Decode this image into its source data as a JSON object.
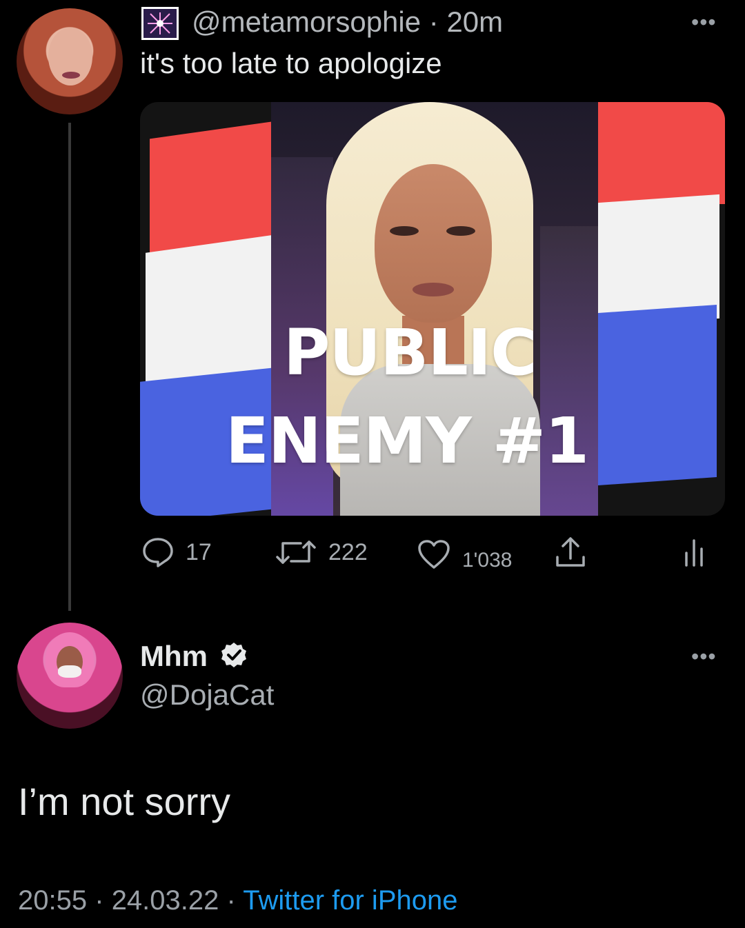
{
  "original_tweet": {
    "handle": "@metamorsophie",
    "separator": "·",
    "time_ago": "20m",
    "text": "it's too late to apologize",
    "media": {
      "headline_line1": "PUBLIC",
      "headline_line2": "ENEMY #1"
    },
    "actions": {
      "reply_count": "17",
      "retweet_count": "222",
      "like_count": "1'038"
    },
    "icons": [
      "reply-icon",
      "retweet-icon",
      "like-icon",
      "share-icon",
      "analytics-icon",
      "more-icon"
    ]
  },
  "reply_tweet": {
    "display_name": "Mhm",
    "handle": "@DojaCat",
    "text": "I’m not sorry",
    "time": "20:55",
    "date": "24.03.22",
    "separator": "·",
    "client": "Twitter for iPhone"
  },
  "colors": {
    "background": "#000000",
    "link": "#1d9bf0",
    "flag_red": "#f14a48",
    "flag_white": "#f2f2f2",
    "flag_blue": "#4a63e0"
  }
}
